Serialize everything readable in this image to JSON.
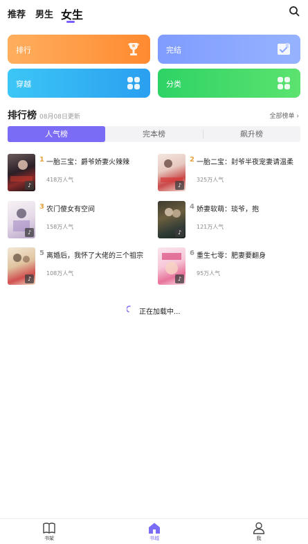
{
  "nav": {
    "tabs": [
      {
        "label": "推荐"
      },
      {
        "label": "男生"
      },
      {
        "label": "女生"
      }
    ],
    "active": "女生"
  },
  "categories": [
    {
      "label": "排行",
      "icon": "trophy-icon"
    },
    {
      "label": "完结",
      "icon": "check-book-icon"
    },
    {
      "label": "穿越",
      "icon": "grid-icon"
    },
    {
      "label": "分类",
      "icon": "grid-icon"
    }
  ],
  "ranking": {
    "title": "排行榜",
    "updated": "08月08日更新",
    "all_label": "全部榜单 ›",
    "tabs": [
      "人气榜",
      "完本榜",
      "飙升榜"
    ],
    "active_tab": "人气榜",
    "books": [
      {
        "num": "1",
        "title": "一胎三宝：爵爷娇妻火辣辣",
        "popularity": "418万人气",
        "num_color": "#e6a23c"
      },
      {
        "num": "2",
        "title": "一胎二宝：封爷半夜宠妻请温柔",
        "popularity": "325万人气",
        "num_color": "#e6a23c"
      },
      {
        "num": "3",
        "title": "农门傻女有空间",
        "popularity": "158万人气",
        "num_color": "#e6a23c"
      },
      {
        "num": "4",
        "title": "娇妻软萌：琰爷，抱",
        "popularity": "121万人气",
        "num_color": "#999999"
      },
      {
        "num": "5",
        "title": "离婚后，我怀了大佬的三个祖宗",
        "popularity": "108万人气",
        "num_color": "#999999"
      },
      {
        "num": "6",
        "title": "重生七零：肥妻要翻身",
        "popularity": "95万人气",
        "num_color": "#999999"
      }
    ]
  },
  "loading": {
    "text": "正在加载中..."
  },
  "bottom_nav": [
    {
      "label": "书架",
      "icon": "book-icon"
    },
    {
      "label": "书城",
      "icon": "home-icon"
    },
    {
      "label": "我",
      "icon": "user-icon"
    }
  ],
  "colors": {
    "accent": "#7b6cf6"
  }
}
